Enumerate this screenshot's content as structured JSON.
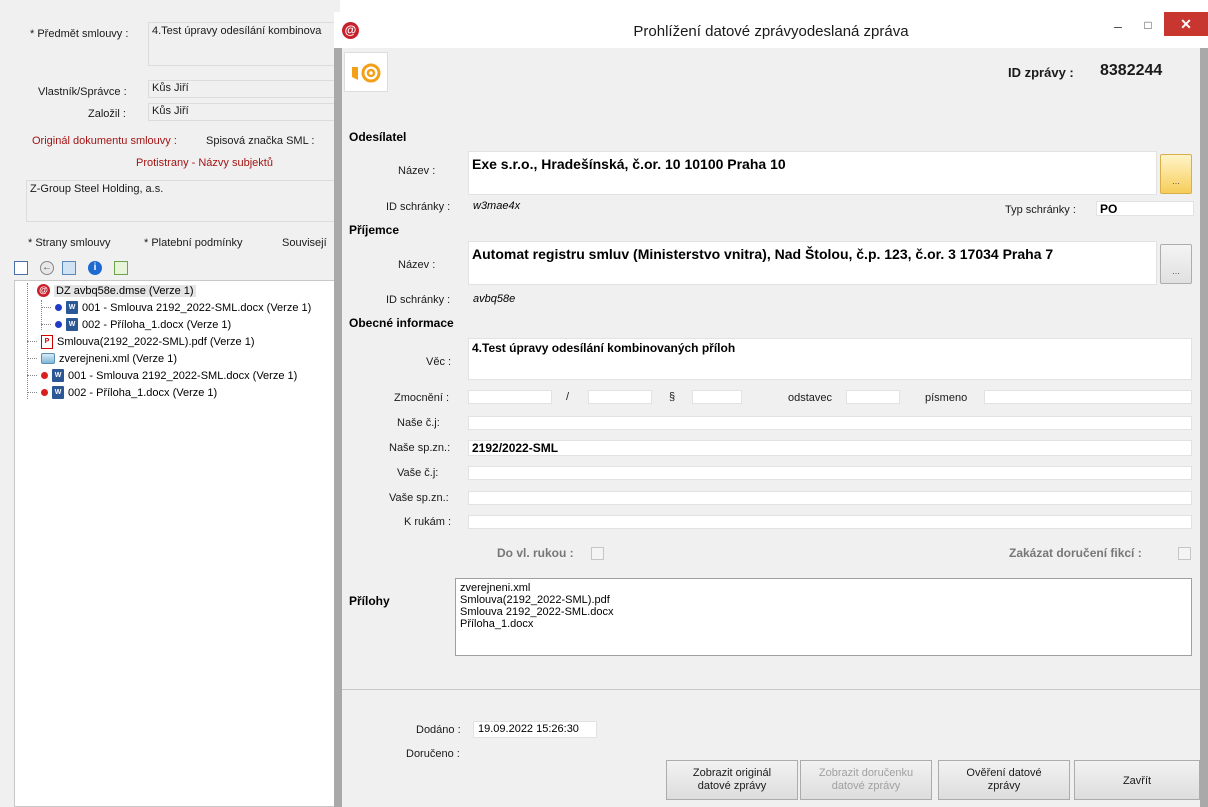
{
  "background": {
    "predmet_label": "* Předmět smlouvy :",
    "predmet_value": "4.Test úpravy odesílání kombinova",
    "vlastnik_label": "Vlastník/Správce :",
    "vlastnik_value": "Kůs Jiří",
    "zalozil_label": "Založil :",
    "zalozil_value": "Kůs Jiří",
    "original_label": "Originál dokumentu smlouvy :",
    "spisova_label": "Spisová značka SML :",
    "protistrany_label": "Protistrany - Názvy subjektů",
    "protistrany_value": "Z-Group Steel Holding, a.s.",
    "tabs": [
      "* Strany smlouvy",
      "* Platební podmínky",
      "Souvisejí"
    ],
    "tree": [
      {
        "label": "DZ avbq58e.dmse (Verze 1)",
        "icon": "dz-message-icon"
      },
      {
        "label": "001 - Smlouva 2192_2022-SML.docx (Verze 1)",
        "icon": "docx-icon",
        "dot": "#1f3cc8"
      },
      {
        "label": "002 - Příloha_1.docx (Verze 1)",
        "icon": "docx-icon",
        "dot": "#1f3cc8"
      },
      {
        "label": "Smlouva(2192_2022-SML).pdf (Verze 1)",
        "icon": "pdf-icon"
      },
      {
        "label": "zverejneni.xml (Verze 1)",
        "icon": "xml-icon"
      },
      {
        "label": "001 - Smlouva 2192_2022-SML.docx (Verze 1)",
        "icon": "docx-icon",
        "dot": "#d81e1e"
      },
      {
        "label": "002 - Příloha_1.docx (Verze 1)",
        "icon": "docx-icon",
        "dot": "#d81e1e"
      }
    ]
  },
  "dialog": {
    "title": "Prohlížení datové zprávyodeslaná zpráva",
    "id_label": "ID zprávy :",
    "id_value": "8382244",
    "odesilatel": {
      "section": "Odesílatel",
      "nazev_label": "Název :",
      "nazev_value": "Exe s.r.o., Hradešínská, č.or. 10 10100 Praha 10",
      "id_label": "ID schránky :",
      "id_value": "w3mae4x",
      "typ_label": "Typ schránky :",
      "typ_value": "PO"
    },
    "prijemce": {
      "section": "Příjemce",
      "nazev_label": "Název :",
      "nazev_value": "Automat registru smluv (Ministerstvo vnitra), Nad Štolou, č.p. 123, č.or. 3 17034 Praha 7",
      "id_label": "ID schránky :",
      "id_value": "avbq58e"
    },
    "obecne": {
      "section": "Obecné informace",
      "vec_label": "Věc :",
      "vec_value": "4.Test úpravy odesílání kombinovaných příloh",
      "zmocneni_label": "Zmocnění :",
      "slash": "/",
      "paragraph": "§",
      "odstavec_label": "odstavec",
      "pismeno_label": "písmeno",
      "nase_cj_label": "Naše č.j:",
      "nase_spzn_label": "Naše sp.zn.:",
      "nase_spzn_value": "2192/2022-SML",
      "vase_cj_label": "Vaše č.j:",
      "vase_spzn_label": "Vaše sp.zn.:",
      "krukam_label": "K rukám :",
      "do_vl_rukou_label": "Do vl. rukou :",
      "zakazat_label": "Zakázat doručení fikcí :"
    },
    "prilohy": {
      "section": "Přílohy",
      "items": [
        "zverejneni.xml",
        "Smlouva(2192_2022-SML).pdf",
        "Smlouva 2192_2022-SML.docx",
        "Příloha_1.docx"
      ]
    },
    "dodano_label": "Dodáno :",
    "dodano_value": "19.09.2022 15:26:30",
    "doruceno_label": "Doručeno :",
    "buttons": {
      "zobrazit_original_1": "Zobrazit originál",
      "zobrazit_original_2": "datové zprávy",
      "zobrazit_dorucenku_1": "Zobrazit doručenku",
      "zobrazit_dorucenku_2": "datové zprávy",
      "overeni_1": "Ověření datové",
      "overeni_2": "zprávy",
      "zavrit": "Zavřít"
    }
  }
}
